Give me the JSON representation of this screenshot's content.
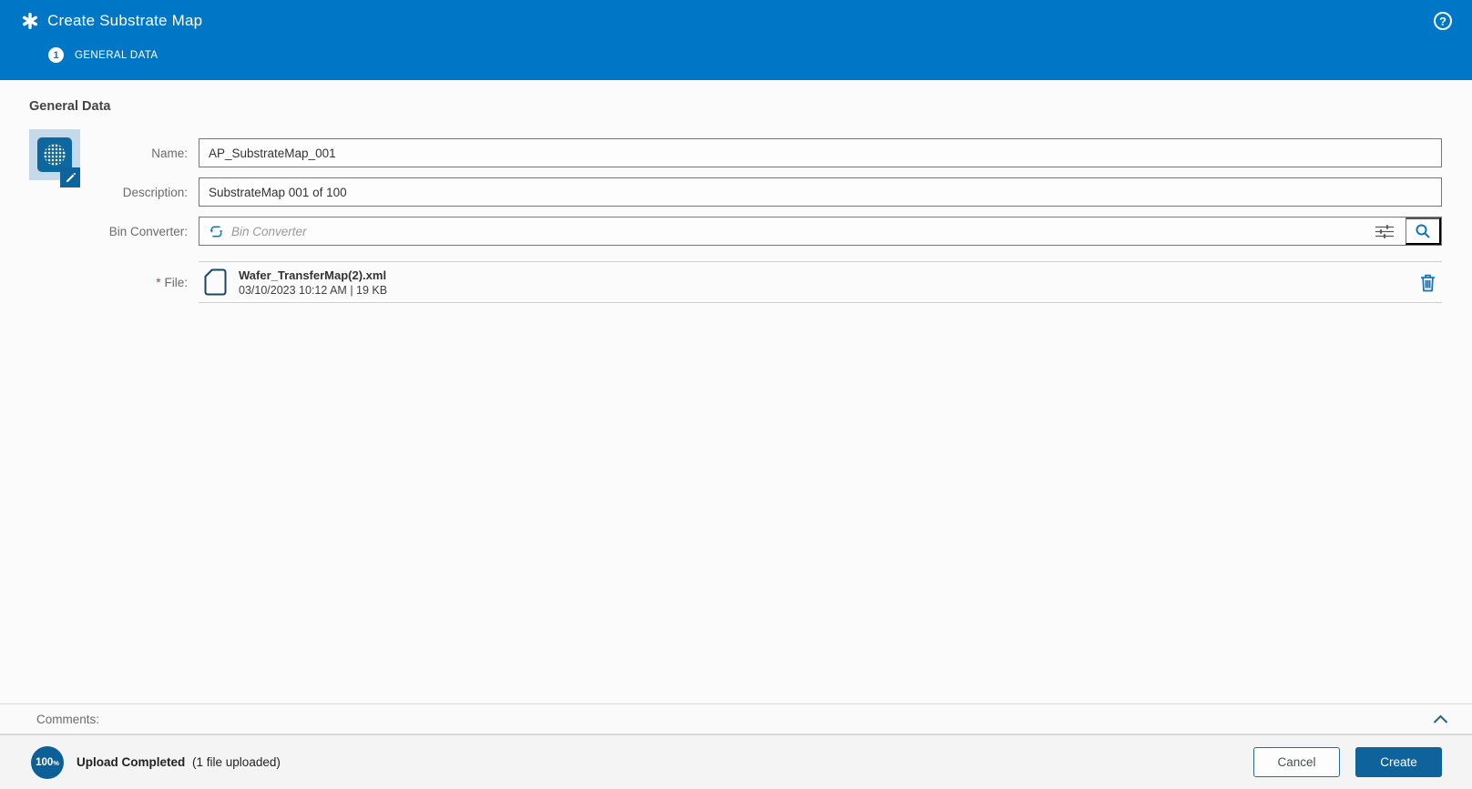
{
  "header": {
    "title": "Create Substrate Map",
    "step_number": "1",
    "step_label": "GENERAL DATA",
    "help_symbol": "?"
  },
  "section_title": "General Data",
  "form": {
    "name": {
      "label": "Name:",
      "value": "AP_SubstrateMap_001"
    },
    "description": {
      "label": "Description:",
      "value": "SubstrateMap 001 of 100"
    },
    "bin_converter": {
      "label": "Bin Converter:",
      "value": "",
      "placeholder": "Bin Converter"
    },
    "file": {
      "required_marker": "*",
      "label": "File:",
      "filename": "Wafer_TransferMap(2).xml",
      "meta": "03/10/2023 10:12 AM | 19 KB"
    }
  },
  "comments_label": "Comments:",
  "footer": {
    "progress_value": "100",
    "progress_unit": "%",
    "status_title": "Upload Completed",
    "status_detail": "(1 file uploaded)",
    "cancel_label": "Cancel",
    "create_label": "Create"
  },
  "icons": {
    "asterisk-icon": "six-spoke asterisk (wizard/create)",
    "help-icon": "circled question mark",
    "step-circle": "numbered step bullet",
    "wafer-map-icon": "blue tile with gridded wafer circle",
    "edit-pencil-icon": "pencil on blue square",
    "sync-icon": "circular refresh arrows",
    "tune-icon": "filter sliders",
    "search-icon": "magnifying glass",
    "document-icon": "file outline with folded corner",
    "trash-icon": "delete trash can",
    "chevron-up-icon": "collapse panel chevron",
    "progress-badge": "100% circle"
  },
  "colors": {
    "header_blue": "#0077c6",
    "accent_dark_blue": "#0e639c",
    "icon_tile_light_blue": "#c5d9ea",
    "icon_blue": "#1272ba",
    "required_red": "#c0392b",
    "input_border": "#767676",
    "divider": "#cfcfcf",
    "footer_bg": "#f4f4f4",
    "page_bg": "#fbfbfb"
  }
}
